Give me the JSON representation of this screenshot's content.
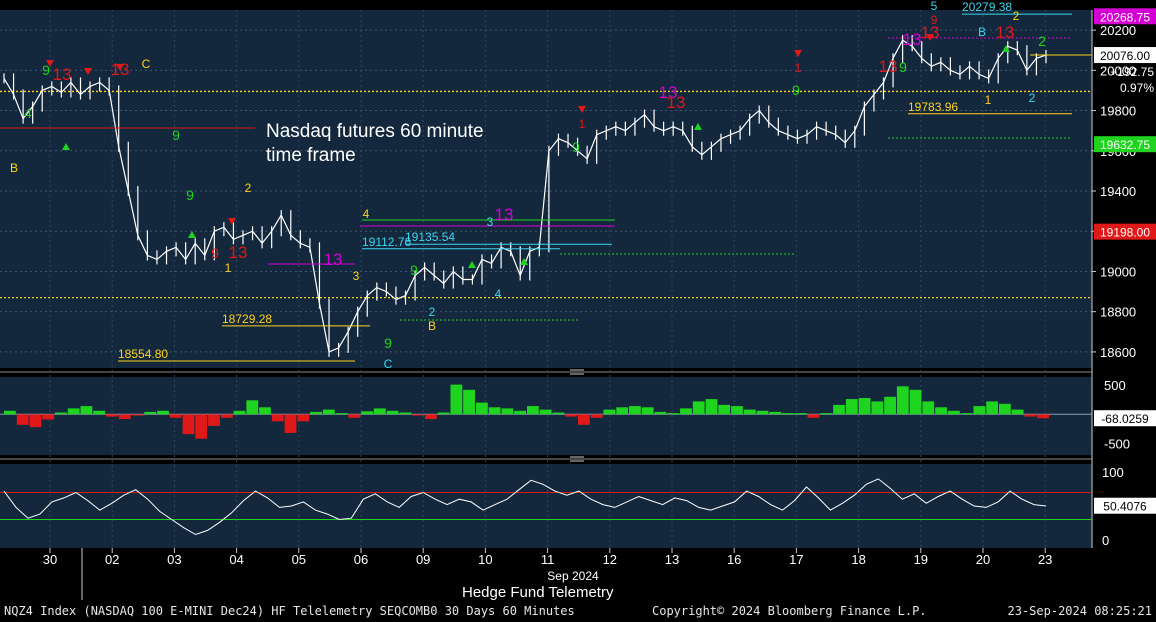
{
  "chart_data": [
    {
      "type": "line",
      "panel": "price",
      "title": "Nasdaq futures 60 minute time frame",
      "y_ticks": [
        18600,
        18800,
        19000,
        19200,
        19400,
        19600,
        19800,
        20000,
        20200
      ],
      "ylim": [
        18520,
        20300
      ],
      "x_ticks": [
        "30",
        "02",
        "03",
        "04",
        "05",
        "06",
        "09",
        "10",
        "11",
        "12",
        "13",
        "16",
        "17",
        "18",
        "19",
        "20",
        "23"
      ],
      "x_group_label": "Sep 2024",
      "last_price": 20076.0,
      "change": "+192.75",
      "change_pct": "0.97%",
      "price_tags": [
        {
          "label": "20268.75",
          "color": "#d400d4"
        },
        {
          "label": "19632.75",
          "color": "#1fd41f"
        },
        {
          "label": "19198.00",
          "color": "#e01818"
        }
      ],
      "level_labels": [
        "18554.80",
        "18729.28",
        "19112.76",
        "19135.54",
        "19783.96",
        "20279.38"
      ],
      "annotation": "Nasdaq futures 60 minute time frame",
      "series": [
        {
          "name": "NQZ4 hourly close",
          "values": [
            19960,
            19880,
            19760,
            19820,
            19900,
            19920,
            19890,
            19940,
            19880,
            19920,
            19940,
            19900,
            19620,
            19400,
            19180,
            19080,
            19060,
            19100,
            19120,
            19060,
            19140,
            19080,
            19200,
            19220,
            19160,
            19180,
            19200,
            19140,
            19200,
            19280,
            19180,
            19140,
            19120,
            18840,
            18600,
            18620,
            18700,
            18800,
            18880,
            18920,
            18900,
            18860,
            18880,
            18980,
            19020,
            18980,
            18940,
            19000,
            18960,
            18960,
            19060,
            19040,
            19120,
            19100,
            18980,
            19100,
            19120,
            19600,
            19660,
            19640,
            19600,
            19560,
            19680,
            19700,
            19720,
            19700,
            19740,
            19780,
            19720,
            19700,
            19720,
            19700,
            19620,
            19580,
            19620,
            19660,
            19680,
            19700,
            19760,
            19800,
            19740,
            19700,
            19680,
            19660,
            19680,
            19720,
            19700,
            19680,
            19640,
            19700,
            19820,
            19880,
            19940,
            20060,
            20150,
            20120,
            20060,
            20020,
            20040,
            20000,
            19980,
            20020,
            19980,
            19960,
            20060,
            20120,
            20100,
            20000,
            20060,
            20076
          ]
        }
      ]
    },
    {
      "type": "bar",
      "panel": "histogram",
      "y_ticks": [
        500,
        -500
      ],
      "ylim": [
        -700,
        640
      ],
      "last_value": "-68.0259",
      "series": [
        {
          "name": "histogram",
          "values": [
            60,
            -180,
            -220,
            -90,
            30,
            100,
            140,
            60,
            -40,
            -80,
            -20,
            40,
            60,
            -60,
            -340,
            -420,
            -200,
            -60,
            60,
            240,
            120,
            -120,
            -320,
            -120,
            40,
            80,
            20,
            -60,
            50,
            100,
            60,
            30,
            -20,
            -80,
            30,
            510,
            420,
            200,
            120,
            100,
            60,
            140,
            80,
            30,
            -40,
            -180,
            -60,
            80,
            120,
            140,
            120,
            40,
            20,
            100,
            220,
            260,
            160,
            140,
            80,
            60,
            40,
            20,
            20,
            -60,
            20,
            160,
            260,
            280,
            220,
            300,
            480,
            420,
            220,
            120,
            60,
            20,
            140,
            220,
            180,
            80,
            -40,
            -68
          ]
        }
      ]
    },
    {
      "type": "line",
      "panel": "oscillator",
      "y_ticks": [
        100,
        50,
        0
      ],
      "ylim": [
        -12,
        112
      ],
      "overbought": 70,
      "oversold": 30,
      "last_value": "50.4076",
      "series": [
        {
          "name": "oscillator",
          "values": [
            72,
            48,
            32,
            38,
            56,
            62,
            70,
            58,
            44,
            54,
            66,
            74,
            60,
            42,
            30,
            18,
            8,
            14,
            26,
            40,
            58,
            72,
            62,
            48,
            50,
            56,
            44,
            38,
            30,
            32,
            60,
            68,
            56,
            48,
            64,
            70,
            60,
            52,
            60,
            56,
            44,
            52,
            60,
            74,
            88,
            82,
            72,
            66,
            72,
            60,
            52,
            48,
            56,
            64,
            58,
            52,
            62,
            58,
            48,
            44,
            50,
            56,
            72,
            64,
            52,
            44,
            58,
            78,
            62,
            44,
            54,
            66,
            82,
            90,
            76,
            60,
            68,
            54,
            64,
            72,
            60,
            50,
            48,
            56,
            72,
            60,
            52,
            50
          ]
        }
      ]
    }
  ],
  "caption": "Hedge Fund Telemetry",
  "footer": {
    "left": "NQZ4 Index (NASDAQ 100 E-MINI Dec24) HF Telelemetry SEQCOMB0 30 Days 60 Minutes",
    "center": "Copyright© 2024 Bloomberg Finance L.P.",
    "right": "23-Sep-2024 08:25:21"
  },
  "colors": {
    "background": "#13283d",
    "bullish": "#1fd41f",
    "bearish": "#e01818",
    "setup_count": "#ffd21a",
    "magenta": "#d400d4",
    "cyan": "#3ad6ee"
  }
}
